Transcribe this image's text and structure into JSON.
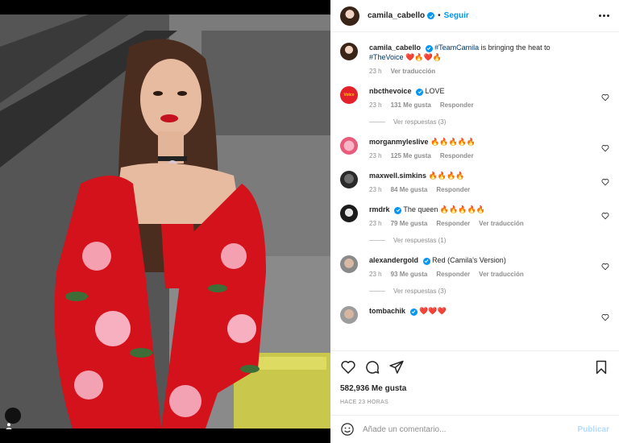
{
  "header": {
    "username": "camila_cabello",
    "separator": "•",
    "follow_label": "Seguir"
  },
  "caption": {
    "username": "camila_cabello",
    "hashtag1": "#TeamCamila",
    "text_mid": " is bringing the heat to ",
    "hashtag2": "#TheVoice",
    "emojis": "❤️🔥❤️🔥",
    "time": "23 h",
    "translate": "Ver traducción"
  },
  "comments": [
    {
      "username": "nbcthevoice",
      "verified": true,
      "text": "LOVE",
      "time": "23 h",
      "likes": "131 Me gusta",
      "reply": "Responder",
      "translate": "",
      "replies": "Ver respuestas (3)",
      "avatar_text": "Voice"
    },
    {
      "username": "morganmyleslive",
      "verified": false,
      "text": "🔥🔥🔥🔥🔥",
      "time": "23 h",
      "likes": "125 Me gusta",
      "reply": "Responder",
      "translate": "",
      "replies": ""
    },
    {
      "username": "maxwell.simkins",
      "verified": false,
      "text": "🔥🔥🔥🔥",
      "time": "23 h",
      "likes": "84 Me gusta",
      "reply": "Responder",
      "translate": "",
      "replies": ""
    },
    {
      "username": "rmdrk",
      "verified": true,
      "text": "The queen 🔥🔥🔥🔥🔥",
      "time": "23 h",
      "likes": "79 Me gusta",
      "reply": "Responder",
      "translate": "Ver traducción",
      "replies": "Ver respuestas (1)"
    },
    {
      "username": "alexandergold",
      "verified": true,
      "text": "Red (Camila's Version)",
      "time": "23 h",
      "likes": "93 Me gusta",
      "reply": "Responder",
      "translate": "Ver traducción",
      "replies": "Ver respuestas (3)"
    },
    {
      "username": "tombachik",
      "verified": true,
      "text": "❤️❤️❤️",
      "time": "",
      "likes": "",
      "reply": "",
      "translate": "",
      "replies": ""
    }
  ],
  "post": {
    "likes": "582,936 Me gusta",
    "time_ago": "HACE 23 HORAS"
  },
  "add_comment": {
    "placeholder": "Añade un comentario...",
    "publish_label": "Publicar"
  },
  "colors": {
    "accent": "#0095f6",
    "publish_disabled": "#b3dbff",
    "muted_text": "#8e8e8e"
  },
  "icons": {
    "like": "heart-icon",
    "comment": "comment-icon",
    "share": "paper-plane-icon",
    "save": "bookmark-icon",
    "emoji": "smiley-icon",
    "more": "more-dots-icon",
    "tag": "person-tag-icon"
  }
}
